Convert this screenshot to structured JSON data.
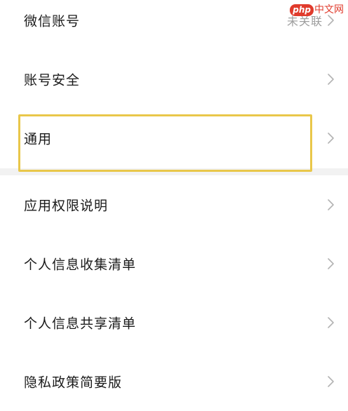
{
  "settings": {
    "items": [
      {
        "label": "微信账号",
        "value": "未关联"
      },
      {
        "label": "账号安全",
        "value": ""
      },
      {
        "label": "通用",
        "value": ""
      },
      {
        "label": "应用权限说明",
        "value": ""
      },
      {
        "label": "个人信息收集清单",
        "value": ""
      },
      {
        "label": "个人信息共享清单",
        "value": ""
      },
      {
        "label": "隐私政策简要版",
        "value": ""
      }
    ]
  },
  "highlight": {
    "color": "#e9c74a",
    "target": "通用"
  },
  "watermark": {
    "badge": "php",
    "text": "中文网"
  }
}
